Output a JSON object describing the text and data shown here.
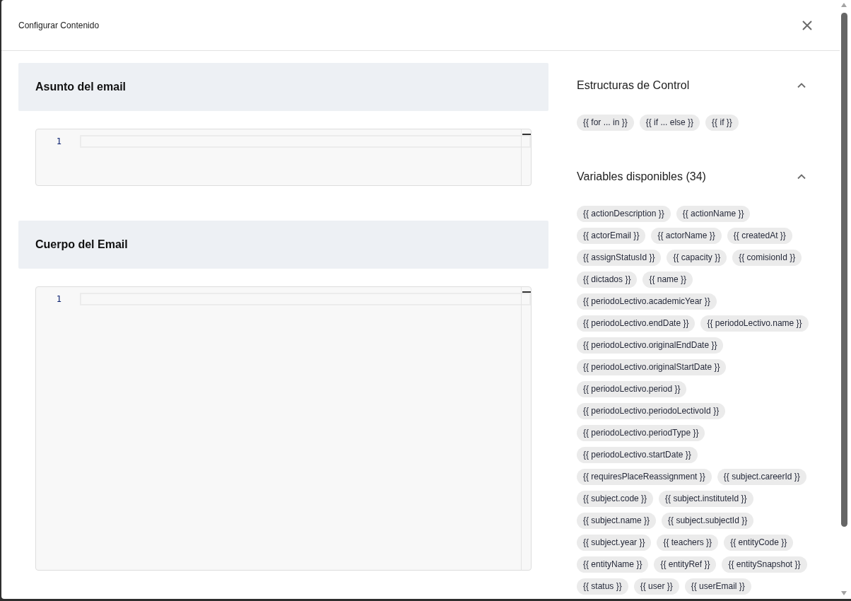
{
  "dialog": {
    "title": "Configurar Contenido"
  },
  "editors": [
    {
      "title": "Asunto del email",
      "lines": [
        {
          "number": "1",
          "current": true
        }
      ]
    },
    {
      "title": "Cuerpo del Email",
      "lines": [
        {
          "number": "1",
          "current": true
        }
      ]
    }
  ],
  "panels": [
    {
      "title": "Estructuras de Control",
      "expanded": true,
      "chips": [
        "{{ for ... in }}",
        "{{ if ... else }}",
        "{{ if }}"
      ]
    },
    {
      "title": "Variables disponibles (34)",
      "expanded": true,
      "chips": [
        "{{ actionDescription }}",
        "{{ actionName }}",
        "{{ actorEmail }}",
        "{{ actorName }}",
        "{{ createdAt }}",
        "{{ assignStatusId }}",
        "{{ capacity }}",
        "{{ comisionId }}",
        "{{ dictados }}",
        "{{ name }}",
        "{{ periodoLectivo.academicYear }}",
        "{{ periodoLectivo.endDate }}",
        "{{ periodoLectivo.name }}",
        "{{ periodoLectivo.originalEndDate }}",
        "{{ periodoLectivo.originalStartDate }}",
        "{{ periodoLectivo.period }}",
        "{{ periodoLectivo.periodoLectivoId }}",
        "{{ periodoLectivo.periodType }}",
        "{{ periodoLectivo.startDate }}",
        "{{ requiresPlaceReassignment }}",
        "{{ subject.careerId }}",
        "{{ subject.code }}",
        "{{ subject.instituteId }}",
        "{{ subject.name }}",
        "{{ subject.subjectId }}",
        "{{ subject.year }}",
        "{{ teachers }}",
        "{{ entityCode }}",
        "{{ entityName }}",
        "{{ entityRef }}",
        "{{ entitySnapshot }}",
        "{{ status }}",
        "{{ user }}",
        "{{ userEmail }}"
      ]
    }
  ]
}
